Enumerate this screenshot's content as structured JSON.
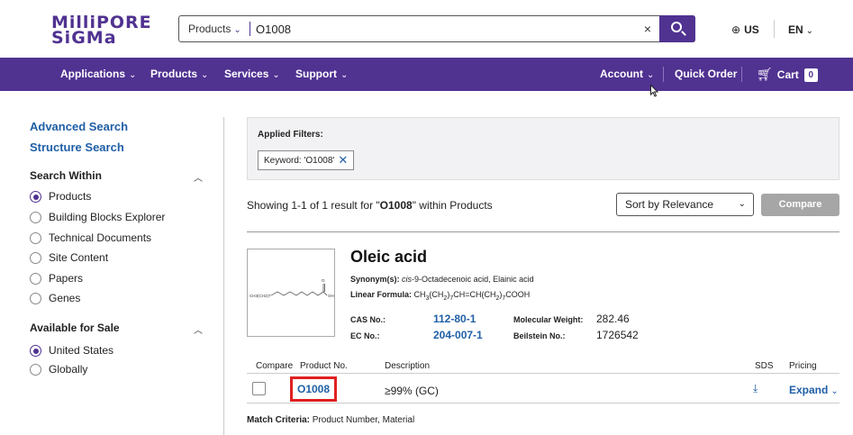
{
  "brand": {
    "line1": "MilliPORE",
    "line2": "SiGMa"
  },
  "search": {
    "scope_label": "Products",
    "query": "O1008",
    "clear_icon": "×"
  },
  "locale": {
    "region": "US",
    "language": "EN"
  },
  "nav": {
    "items": [
      "Applications",
      "Products",
      "Services",
      "Support"
    ],
    "account": "Account",
    "quick_order": "Quick Order",
    "cart": "Cart",
    "cart_count": "0"
  },
  "sidebar": {
    "links": [
      "Advanced Search",
      "Structure Search"
    ],
    "search_within": {
      "title": "Search Within",
      "options": [
        "Products",
        "Building Blocks Explorer",
        "Technical Documents",
        "Site Content",
        "Papers",
        "Genes"
      ],
      "selected": "Products"
    },
    "available_for_sale": {
      "title": "Available for Sale",
      "options": [
        "United States",
        "Globally"
      ],
      "selected": "United States"
    }
  },
  "filters": {
    "title": "Applied Filters:",
    "chip": "Keyword: 'O1008'"
  },
  "results": {
    "prefix": "Showing 1-1 of 1 result for \"",
    "query": "O1008",
    "suffix": "\" within Products",
    "sort": "Sort by Relevance",
    "compare": "Compare"
  },
  "product": {
    "name": "Oleic acid",
    "structure_label": "CH3(CH2)7",
    "structure_end": "OH",
    "synonyms_label": "Synonym(s):",
    "synonyms_italic": "cis",
    "synonyms_rest": "-9-Octadecenoic acid, Elainic acid",
    "linear_label": "Linear Formula:",
    "cas_label": "CAS No.:",
    "cas": "112-80-1",
    "ec_label": "EC No.:",
    "ec": "204-007-1",
    "mw_label": "Molecular Weight:",
    "mw": "282.46",
    "beilstein_label": "Beilstein No.:",
    "beilstein": "1726542"
  },
  "table": {
    "headers": [
      "Compare",
      "Product No.",
      "Description",
      "SDS",
      "Pricing"
    ],
    "rows": [
      {
        "product_no": "O1008",
        "description": "≥99% (GC)",
        "sds_icon": "download-icon",
        "pricing": "Expand"
      }
    ]
  },
  "match": {
    "label": "Match Criteria:",
    "value": "Product Number, Material"
  },
  "colors": {
    "brand": "#503291",
    "link": "#1f5fa6",
    "highlight": "#e02020"
  }
}
